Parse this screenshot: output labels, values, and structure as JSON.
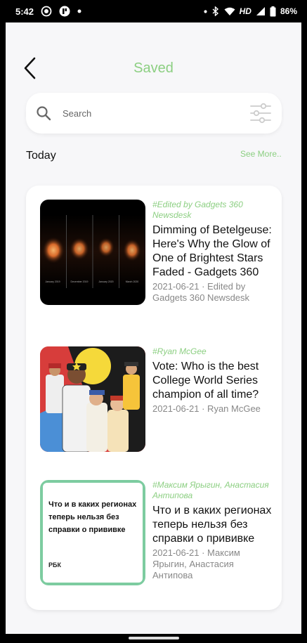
{
  "status_bar": {
    "time": "5:42",
    "network": "HD",
    "battery": "86%"
  },
  "header": {
    "title": "Saved"
  },
  "search": {
    "placeholder": "Search"
  },
  "section": {
    "title": "Today",
    "see_more": "See More.."
  },
  "articles": [
    {
      "tag": "#Edited by Gadgets 360 Newsdesk",
      "headline": "Dimming of Betelgeuse: Here's Why the Glow of One of Brightest Stars Faded - Gadgets 360",
      "meta": "2021-06-21 · Edited by Gadgets 360 Newsdesk",
      "thumb_labels": [
        "January 2019",
        "December 2019",
        "January 2020",
        "March 2020"
      ]
    },
    {
      "tag": "#Ryan McGee",
      "headline": "Vote: Who is the best College World Series champion of all time?",
      "meta": "2021-06-21 · Ryan McGee"
    },
    {
      "tag": "#Максим Ярыгин, Анастасия Антипова",
      "headline": "Что и в каких регионах теперь нельзя без справки о прививке",
      "meta": "2021-06-21 · Максим Ярыгин, Анастасия Антипова",
      "thumb_text": "Что и в каких регионах теперь нельзя без справки о прививке",
      "thumb_brand": "РБК"
    }
  ],
  "colors": {
    "accent": "#8ccf82",
    "background": "#f7f7f9"
  }
}
